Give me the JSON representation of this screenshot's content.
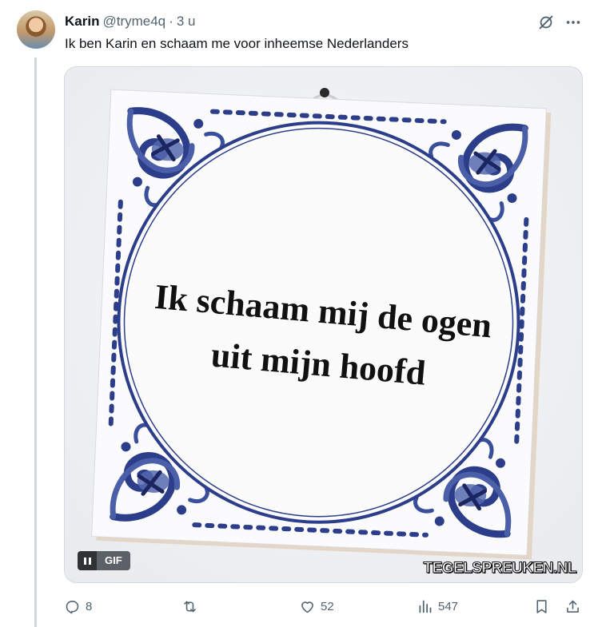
{
  "tweet": {
    "author": {
      "display_name": "Karin",
      "handle": "@tryme4q",
      "separator": "·",
      "time": "3 u"
    },
    "text": "Ik ben Karin en schaam me voor inheemse Nederlanders",
    "media": {
      "tile_text_line1": "Ik schaam mij de ogen",
      "tile_text_line2": "uit mijn hoofd",
      "gif_badge": "GIF",
      "watermark": "TEGELSPREUKEN.NL"
    },
    "actions": {
      "replies": "8",
      "retweets": "",
      "likes": "52",
      "views": "547"
    }
  },
  "icons": {
    "top": [
      "grok-icon",
      "more-icon"
    ],
    "actions": [
      "reply-icon",
      "retweet-icon",
      "like-icon",
      "views-icon",
      "bookmark-icon",
      "share-icon"
    ]
  },
  "colors": {
    "text": "#0f1419",
    "secondary": "#536471",
    "border": "#cfd9de",
    "delft_blue": "#2c3e8a"
  }
}
